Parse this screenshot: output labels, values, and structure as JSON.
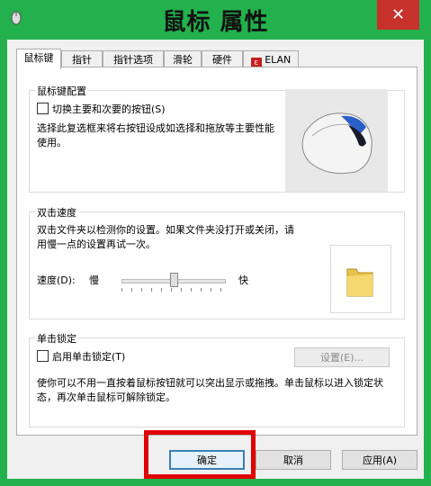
{
  "window": {
    "title": "鼠标 属性",
    "close_label": "✕"
  },
  "tabs": [
    {
      "label": "鼠标键"
    },
    {
      "label": "指针"
    },
    {
      "label": "指针选项"
    },
    {
      "label": "滑轮"
    },
    {
      "label": "硬件"
    },
    {
      "label": "ELAN"
    }
  ],
  "buttons_config": {
    "group_title": "鼠标键配置",
    "swap_label": "切换主要和次要的按钮(S)",
    "swap_checked": false,
    "description": "选择此复选框来将右按钮设成如选择和拖放等主要性能使用。"
  },
  "double_click": {
    "group_title": "双击速度",
    "description": "双击文件夹以检测你的设置。如果文件夹没打开或关闭，请用慢一点的设置再试一次。",
    "speed_label": "速度(D):",
    "slow_label": "慢",
    "fast_label": "快",
    "speed_value": 0.5
  },
  "click_lock": {
    "group_title": "单击锁定",
    "enable_label": "启用单击锁定(T)",
    "enable_checked": false,
    "settings_label": "设置(E)...",
    "description": "使你可以不用一直按着鼠标按钮就可以突出显示或拖拽。单击鼠标以进入锁定状态，再次单击鼠标可解除锁定。"
  },
  "footer": {
    "ok_label": "确定",
    "cancel_label": "取消",
    "apply_label": "应用(A)"
  },
  "colors": {
    "background": "#22b14c",
    "close": "#c7312b",
    "highlight": "#e00000"
  }
}
